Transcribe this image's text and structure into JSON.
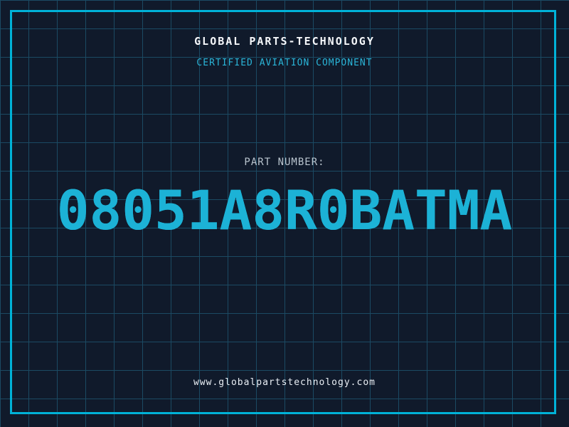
{
  "certificate": {
    "company_title": "GLOBAL PARTS-TECHNOLOGY",
    "subtitle": "CERTIFIED AVIATION COMPONENT",
    "part_label": "PART NUMBER:",
    "part_number": "08051A8R0BATMA",
    "website_url": "www.globalpartstechnology.com"
  },
  "colors": {
    "background": "#101a2b",
    "grid_line": "#1b4a63",
    "frame_border": "#00b2d8",
    "title_text": "#f5f7fa",
    "subtitle_text": "#2ab5d8",
    "part_label_text": "#b9c4ce",
    "part_number_text": "#1cb2d6",
    "footer_text": "#e9eef4"
  },
  "layout_meta": {
    "grid_cell_px": "40"
  }
}
